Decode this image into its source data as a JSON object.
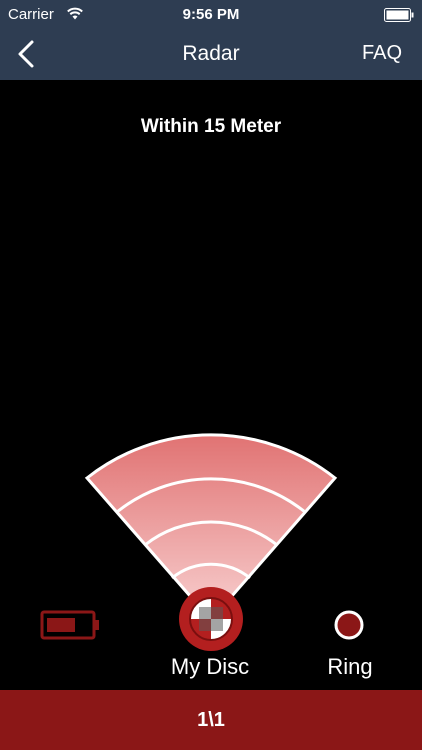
{
  "status_bar": {
    "carrier": "Carrier",
    "time": "9:56 PM",
    "wifi_icon": "wifi-icon",
    "battery_icon": "battery-icon"
  },
  "nav": {
    "title": "Radar",
    "back_icon": "chevron-left-icon",
    "faq_label": "FAQ"
  },
  "radar": {
    "range_text": "Within 15 Meter",
    "colors": {
      "background": "#000000",
      "nav_bar": "#2e3d52",
      "accent": "#8b1717",
      "wedge_outer": "#e07878",
      "wedge_inner": "#f5c9c9"
    }
  },
  "devices": {
    "battery_icon": "battery-low-icon",
    "disc_label": "My Disc",
    "ring_label": "Ring"
  },
  "footer": {
    "page_indicator": "1\\1"
  }
}
